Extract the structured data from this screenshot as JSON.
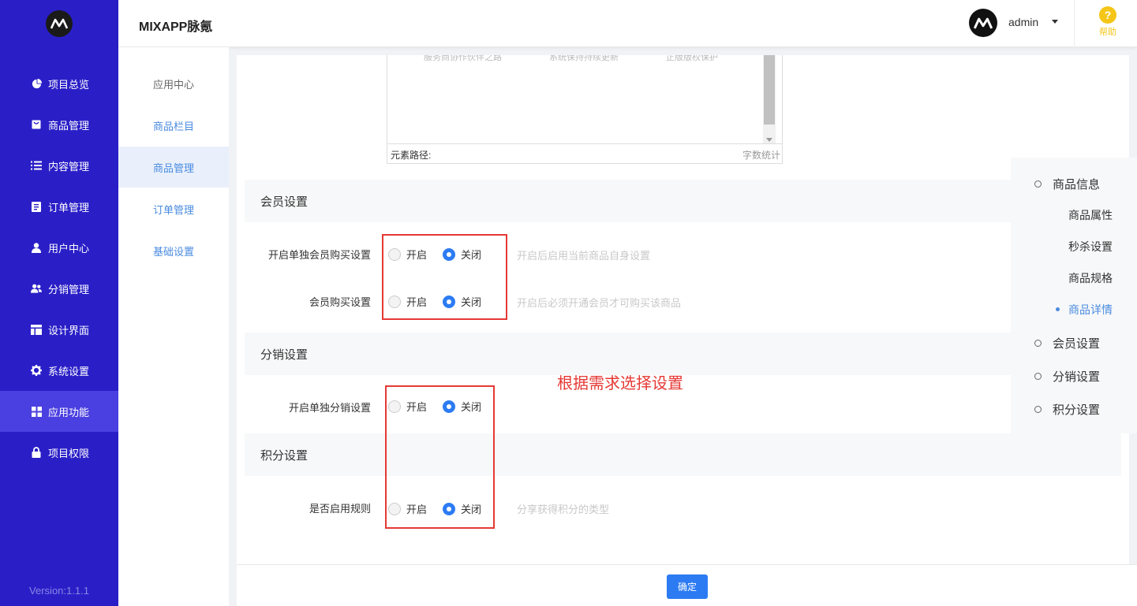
{
  "app": {
    "title": "MIXAPP脉氪"
  },
  "sidebar": {
    "items": [
      {
        "label": "项目总览",
        "icon": "pie-chart-icon"
      },
      {
        "label": "商品管理",
        "icon": "shopping-bag-icon"
      },
      {
        "label": "内容管理",
        "icon": "list-icon"
      },
      {
        "label": "订单管理",
        "icon": "document-icon"
      },
      {
        "label": "用户中心",
        "icon": "user-icon"
      },
      {
        "label": "分销管理",
        "icon": "users-icon"
      },
      {
        "label": "设计界面",
        "icon": "layout-icon"
      },
      {
        "label": "系统设置",
        "icon": "gear-icon"
      },
      {
        "label": "应用功能",
        "icon": "grid-icon",
        "active": true
      },
      {
        "label": "项目权限",
        "icon": "lock-icon"
      }
    ],
    "version": "Version:1.1.1"
  },
  "header": {
    "user": "admin",
    "help_label": "帮助",
    "help_glyph": "?"
  },
  "subnav": {
    "items": [
      {
        "label": "应用中心"
      },
      {
        "label": "商品栏目"
      },
      {
        "label": "商品管理",
        "active": true
      },
      {
        "label": "订单管理"
      },
      {
        "label": "基础设置"
      }
    ]
  },
  "editor": {
    "faded_text": [
      "服务商协作伙伴之路",
      "系统保持持续更新",
      "正版版权保护"
    ],
    "path_label": "元素路径:",
    "word_count_label": "字数统计"
  },
  "sections": {
    "member": {
      "title": "会员设置",
      "rows": [
        {
          "label": "开启单独会员购买设置",
          "on": "开启",
          "off": "关闭",
          "selected": "关闭",
          "hint": "开启后启用当前商品自身设置"
        },
        {
          "label": "会员购买设置",
          "on": "开启",
          "off": "关闭",
          "selected": "关闭",
          "hint": "开启后必须开通会员才可购买该商品"
        }
      ]
    },
    "distribution": {
      "title": "分销设置",
      "rows": [
        {
          "label": "开启单独分销设置",
          "on": "开启",
          "off": "关闭",
          "selected": "关闭"
        }
      ]
    },
    "points": {
      "title": "积分设置",
      "rows": [
        {
          "label": "是否启用规则",
          "on": "开启",
          "off": "关闭",
          "selected": "关闭",
          "hint": "分享获得积分的类型"
        }
      ]
    }
  },
  "annotation": "根据需求选择设置",
  "anchors": {
    "main": [
      "商品信息",
      "会员设置",
      "分销设置",
      "积分设置"
    ],
    "sub": [
      "商品属性",
      "秒杀设置",
      "商品规格",
      "商品详情"
    ],
    "active_sub": "商品详情"
  },
  "footer": {
    "confirm_label": "确定"
  },
  "colors": {
    "sidebar_bg": "#2a1fc7",
    "primary": "#2c7bf3",
    "annotation": "#e53935"
  }
}
